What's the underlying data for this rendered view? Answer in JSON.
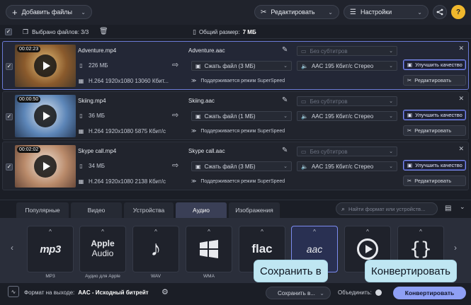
{
  "toolbar": {
    "add_files": "Добавить файлы",
    "edit": "Редактировать",
    "settings": "Настройки",
    "help": "?"
  },
  "subbar": {
    "selected": "Выбрано файлов: 3/3",
    "total_label": "Общий размер:",
    "total_value": "7 МБ"
  },
  "files": [
    {
      "duration": "00:02:23",
      "name": "Adventure.mp4",
      "size": "226 МБ",
      "codec": "H.264 1920x1080 13060 Кбит...",
      "out_name": "Adventure.aac",
      "compress": "Сжать файл (3 МБ)",
      "superspeed": "Поддерживается режим SuperSpeed",
      "subs": "Без субтитров",
      "audio": "AAC 195 Кбит/с Стерео",
      "enhance": "Улучшить качество",
      "edit": "Редактировать",
      "thumb_colors": [
        "#8a5a2c",
        "#e9c27b",
        "#4a3a2a"
      ]
    },
    {
      "duration": "00:00:50",
      "name": "Skiing.mp4",
      "size": "36 МБ",
      "codec": "H.264 1920x1080 5875 Кбит/с",
      "out_name": "Skiing.aac",
      "compress": "Сжать файл (1 МБ)",
      "superspeed": "Поддерживается режим SuperSpeed",
      "subs": "Без субтитров",
      "audio": "AAC 195 Кбит/с Стерео",
      "enhance": "Улучшить качество",
      "edit": "Редактировать",
      "thumb_colors": [
        "#5d86b8",
        "#dfe8f2",
        "#2a3e5c"
      ]
    },
    {
      "duration": "00:02:02",
      "name": "Skype call.mp4",
      "size": "34 МБ",
      "codec": "H.264 1920x1080 2138 Кбит/с",
      "out_name": "Skype call.aac",
      "compress": "Сжать файл (3 МБ)",
      "superspeed": "Поддерживается режим SuperSpeed",
      "subs": "Без субтитров",
      "audio": "AAC 195 Кбит/с Стерео",
      "enhance": "Улучшить качество",
      "edit": "Редактировать",
      "thumb_colors": [
        "#b98a6a",
        "#f1e4d8",
        "#6b4a3a"
      ]
    }
  ],
  "tabs": [
    "Популярные",
    "Видео",
    "Устройства",
    "Аудио",
    "Изображения"
  ],
  "active_tab": "Аудио",
  "search_placeholder": "Найти формат или устройств...",
  "formats": [
    {
      "label": "MP3",
      "icon": "mp3"
    },
    {
      "label": "Аудио для Apple",
      "icon": "Apple Audio"
    },
    {
      "label": "WAV",
      "icon": "note"
    },
    {
      "label": "WMA",
      "icon": "windows"
    },
    {
      "label": "",
      "icon": "flac"
    },
    {
      "label": "",
      "icon": "aac"
    },
    {
      "label": "",
      "icon": "play-circle"
    },
    {
      "label": "",
      "icon": "braces"
    }
  ],
  "bottom": {
    "output_label": "Формат на выходе:",
    "output_value": "AAC - Исходный битрейт",
    "save": "Сохранить в...",
    "merge": "Объединить:",
    "convert": "Конвертировать"
  },
  "tooltips": {
    "save": "Сохранить в",
    "convert": "Конвертировать"
  },
  "colors": {
    "accent": "#8fa0f5",
    "tooltip": "#bfe6f2",
    "help": "#f0b82d"
  }
}
